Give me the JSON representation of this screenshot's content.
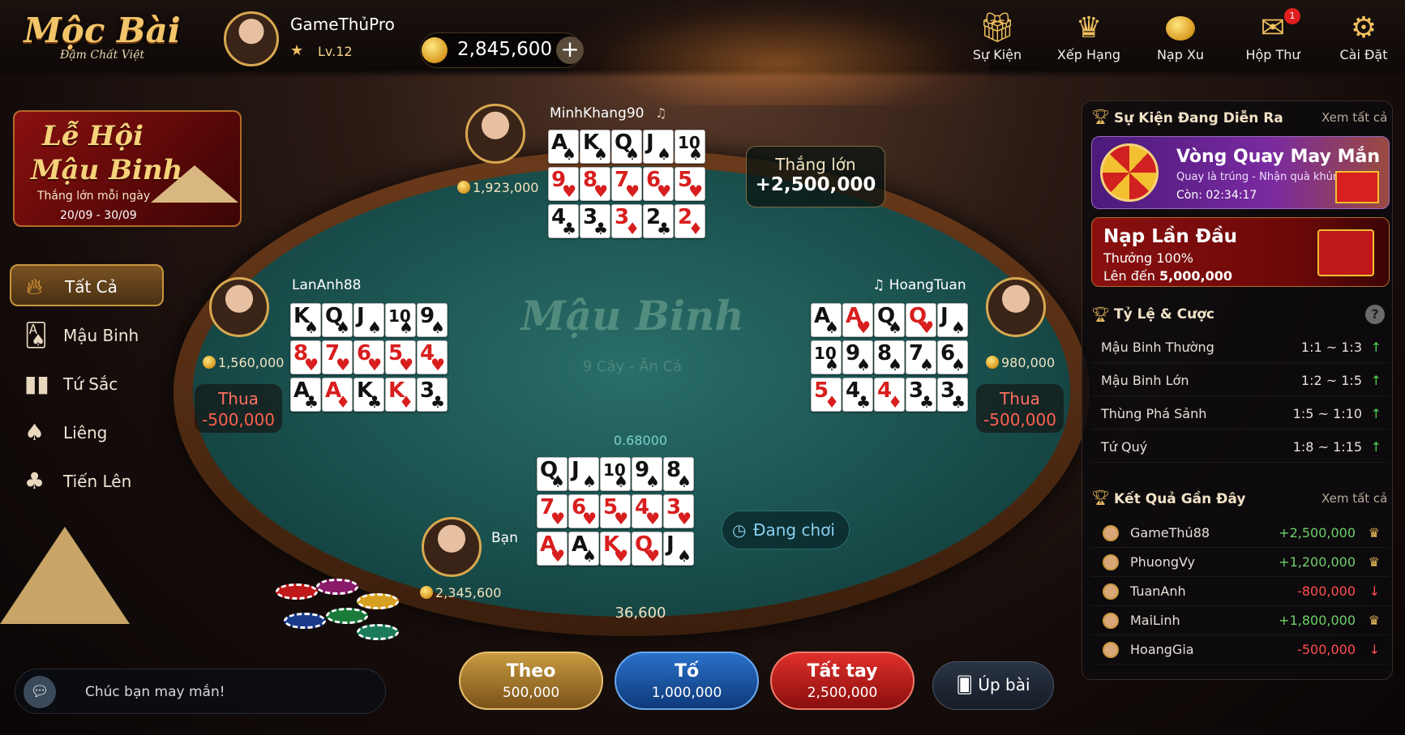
{
  "header": {
    "logo": {
      "title": "Mộc Bài",
      "subtitle": "Đậm Chất Việt"
    },
    "player": {
      "name": "GameThủPro",
      "level": "Lv.12",
      "coins": "2,845,600"
    },
    "nav": [
      {
        "label": "Sự Kiện",
        "icon": "gift-icon"
      },
      {
        "label": "Xếp Hạng",
        "icon": "crown-icon"
      },
      {
        "label": "Nạp Xu",
        "icon": "coins-icon"
      },
      {
        "label": "Hộp Thư",
        "icon": "mail-icon",
        "badge": "1"
      },
      {
        "label": "Cài Đặt",
        "icon": "gear-icon"
      }
    ]
  },
  "promo_banner": {
    "title1": "Lễ Hội",
    "title2": "Mậu Binh",
    "line": "Thắng lớn mỗi ngày",
    "dates": "20/09 - 30/09"
  },
  "sidebar": {
    "items": [
      {
        "label": "Tất Cả",
        "icon": "fire-icon",
        "active": true
      },
      {
        "label": "Mậu Binh",
        "icon": "cards-icon"
      },
      {
        "label": "Tứ Sắc",
        "icon": "tu-sac-cards-icon"
      },
      {
        "label": "Liêng",
        "icon": "spade-icon"
      },
      {
        "label": "Tiến Lên",
        "icon": "club-icon"
      }
    ]
  },
  "table": {
    "title": "Mậu Binh",
    "subtitle": "9 Cây - Ăn Cả",
    "pot": "0.68000",
    "pot_bottom": "36,600",
    "status": "Đang chơi",
    "players": {
      "top": {
        "name": "MinhKhang90",
        "money": "1,923,000",
        "result_label": "Thắng lớn",
        "result_amount": "+2,500,000",
        "rows": [
          [
            {
              "r": "A",
              "s": "♠"
            },
            {
              "r": "K",
              "s": "♠"
            },
            {
              "r": "Q",
              "s": "♠"
            },
            {
              "r": "J",
              "s": "♠"
            },
            {
              "r": "10",
              "s": "♠"
            }
          ],
          [
            {
              "r": "9",
              "s": "♥"
            },
            {
              "r": "8",
              "s": "♥"
            },
            {
              "r": "7",
              "s": "♥"
            },
            {
              "r": "6",
              "s": "♥"
            },
            {
              "r": "5",
              "s": "♥"
            }
          ],
          [
            {
              "r": "4",
              "s": "♣"
            },
            {
              "r": "3",
              "s": "♣"
            },
            {
              "r": "3",
              "s": "♦"
            },
            {
              "r": "2",
              "s": "♣"
            },
            {
              "r": "2",
              "s": "♦"
            }
          ]
        ]
      },
      "left": {
        "name": "LanAnh88",
        "money": "1,560,000",
        "result_label": "Thua",
        "result_amount": "-500,000",
        "rows": [
          [
            {
              "r": "K",
              "s": "♠"
            },
            {
              "r": "Q",
              "s": "♠"
            },
            {
              "r": "J",
              "s": "♠"
            },
            {
              "r": "10",
              "s": "♠"
            },
            {
              "r": "9",
              "s": "♠"
            }
          ],
          [
            {
              "r": "8",
              "s": "♥"
            },
            {
              "r": "7",
              "s": "♥"
            },
            {
              "r": "6",
              "s": "♥"
            },
            {
              "r": "5",
              "s": "♥"
            },
            {
              "r": "4",
              "s": "♥"
            }
          ],
          [
            {
              "r": "A",
              "s": "♣"
            },
            {
              "r": "A",
              "s": "♦"
            },
            {
              "r": "K",
              "s": "♣"
            },
            {
              "r": "K",
              "s": "♦"
            },
            {
              "r": "3",
              "s": "♣"
            }
          ]
        ]
      },
      "right": {
        "name": "HoangTuan",
        "money": "980,000",
        "result_label": "Thua",
        "result_amount": "-500,000",
        "rows": [
          [
            {
              "r": "A",
              "s": "♠"
            },
            {
              "r": "A",
              "s": "♥"
            },
            {
              "r": "Q",
              "s": "♠"
            },
            {
              "r": "Q",
              "s": "♥"
            },
            {
              "r": "J",
              "s": "♠"
            }
          ],
          [
            {
              "r": "10",
              "s": "♠"
            },
            {
              "r": "9",
              "s": "♠"
            },
            {
              "r": "8",
              "s": "♠"
            },
            {
              "r": "7",
              "s": "♠"
            },
            {
              "r": "6",
              "s": "♠"
            }
          ],
          [
            {
              "r": "5",
              "s": "♦"
            },
            {
              "r": "4",
              "s": "♣"
            },
            {
              "r": "4",
              "s": "♦"
            },
            {
              "r": "3",
              "s": "♣"
            },
            {
              "r": "3",
              "s": "♣"
            }
          ]
        ]
      },
      "me": {
        "name": "Bạn",
        "money": "2,345,600",
        "rows": [
          [
            {
              "r": "Q",
              "s": "♠"
            },
            {
              "r": "J",
              "s": "♠"
            },
            {
              "r": "10",
              "s": "♠"
            },
            {
              "r": "9",
              "s": "♠"
            },
            {
              "r": "8",
              "s": "♠"
            }
          ],
          [
            {
              "r": "7",
              "s": "♥"
            },
            {
              "r": "6",
              "s": "♥"
            },
            {
              "r": "5",
              "s": "♥"
            },
            {
              "r": "4",
              "s": "♥"
            },
            {
              "r": "3",
              "s": "♥"
            }
          ],
          [
            {
              "r": "A",
              "s": "♥"
            },
            {
              "r": "A",
              "s": "♠"
            },
            {
              "r": "K",
              "s": "♥"
            },
            {
              "r": "Q",
              "s": "♥"
            },
            {
              "r": "J",
              "s": "♠"
            }
          ]
        ]
      }
    }
  },
  "actions": [
    {
      "label": "Theo",
      "amount": "500,000"
    },
    {
      "label": "Tố",
      "amount": "1,000,000"
    },
    {
      "label": "Tất tay",
      "amount": "2,500,000"
    },
    {
      "label": "Úp bài"
    }
  ],
  "chat": {
    "placeholder": "Chúc bạn may mắn!"
  },
  "right_panel": {
    "events": {
      "title": "Sự Kiện Đang Diễn Ra",
      "more": "Xem tất cả",
      "wheel": {
        "title": "Vòng Quay May Mắn",
        "desc": "Quay là trúng - Nhận quà khủng",
        "timer": "Còn: 02:34:17"
      },
      "first_topup": {
        "title": "Nạp Lần Đầu",
        "line1": "Thưởng 100%",
        "line2_prefix": "Lên đến ",
        "line2_amount": "5,000,000"
      }
    },
    "odds": {
      "title": "Tỷ Lệ & Cược",
      "rows": [
        {
          "name": "Mậu Binh Thường",
          "ratio": "1:1 ~ 1:3"
        },
        {
          "name": "Mậu Binh Lớn",
          "ratio": "1:2 ~ 1:5"
        },
        {
          "name": "Thùng Phá Sảnh",
          "ratio": "1:5 ~ 1:10"
        },
        {
          "name": "Tứ Quý",
          "ratio": "1:8 ~ 1:15"
        }
      ]
    },
    "results": {
      "title": "Kết Quả Gần Đây",
      "more": "Xem tất cả",
      "rows": [
        {
          "name": "GameThủ88",
          "amount": "+2,500,000",
          "win": true
        },
        {
          "name": "PhuongVy",
          "amount": "+1,200,000",
          "win": true
        },
        {
          "name": "TuanAnh",
          "amount": "-800,000",
          "win": false
        },
        {
          "name": "MaiLinh",
          "amount": "+1,800,000",
          "win": true
        },
        {
          "name": "HoangGia",
          "amount": "-500,000",
          "win": false
        }
      ]
    }
  },
  "colors": {
    "gold": "#f2c060",
    "win": "#6fd06a",
    "loss": "#ff5050",
    "felt": "#1c5552"
  }
}
